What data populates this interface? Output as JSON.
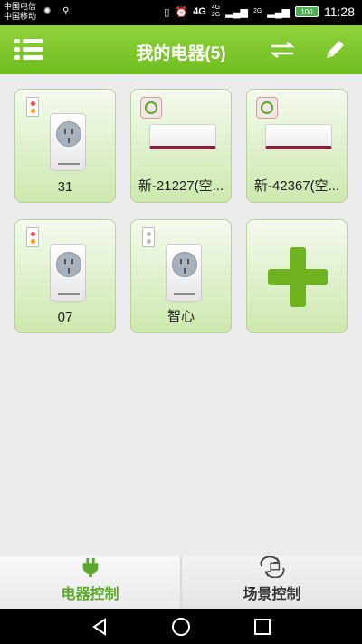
{
  "status": {
    "carrier1": "中国电信",
    "carrier2": "中国移动",
    "network": "4G",
    "net_small_top": "4G",
    "net_small_bottom": "2G",
    "net2_top": "2G",
    "battery": "100",
    "time": "11:28"
  },
  "header": {
    "title": "我的电器(5)",
    "menu_icon": "list-menu-icon",
    "swap_icon": "swap-arrows-icon",
    "edit_icon": "pencil-icon"
  },
  "devices": [
    {
      "label": "31",
      "type": "smart-plug"
    },
    {
      "label": "新-21227(空...",
      "type": "air-conditioner"
    },
    {
      "label": "新-42367(空...",
      "type": "air-conditioner"
    },
    {
      "label": "07",
      "type": "smart-plug"
    },
    {
      "label": "智心",
      "type": "smart-plug"
    }
  ],
  "add_tile": {
    "icon": "plus-icon"
  },
  "tabs": [
    {
      "label": "电器控制",
      "icon": "plug-icon",
      "active": true
    },
    {
      "label": "场景控制",
      "icon": "scene-refresh-icon",
      "active": false
    }
  ],
  "colors": {
    "accent": "#6fbd20",
    "active_tab_text": "#5aa92a"
  }
}
